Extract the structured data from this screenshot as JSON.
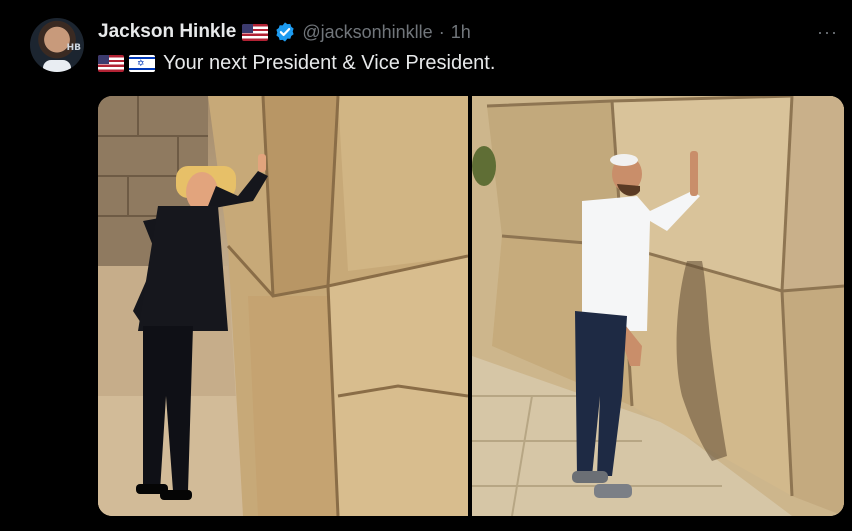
{
  "tweet": {
    "author_name": "Jackson Hinkle",
    "handle": "@jacksonhinklle",
    "separator": "·",
    "time": "1h",
    "text": "Your next President & Vice President.",
    "avatar_badge_text": "HB",
    "author_flag_icon": "us-flag-icon",
    "text_flag_icons": [
      "us-flag-icon",
      "israel-flag-icon"
    ],
    "more_label": "···"
  },
  "media": {
    "images": [
      {
        "name": "photo-left",
        "description_icon": "western-wall-photo"
      },
      {
        "name": "photo-right",
        "description_icon": "western-wall-photo"
      }
    ]
  },
  "colors": {
    "background": "#000000",
    "text": "#e7e9ea",
    "muted": "#71767b",
    "verified": "#1d9bf0"
  }
}
